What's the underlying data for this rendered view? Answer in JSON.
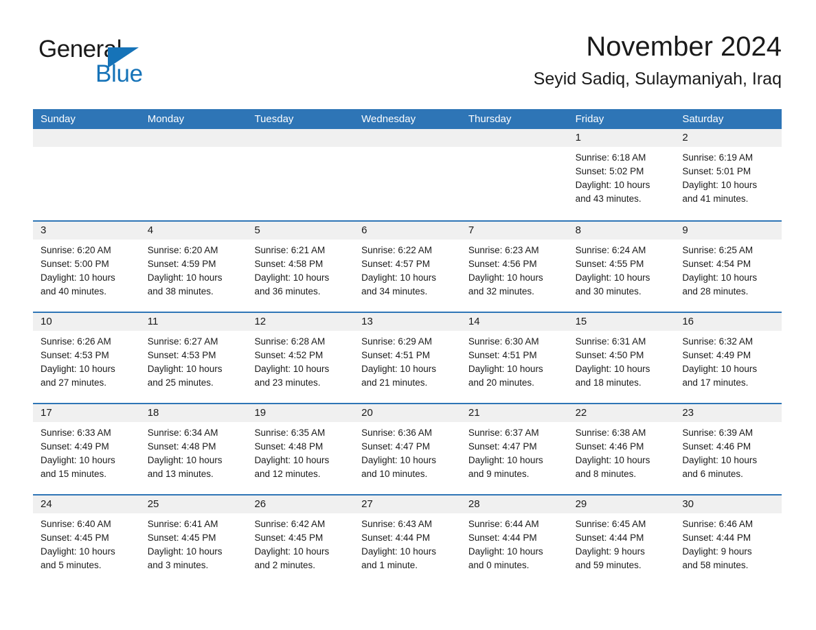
{
  "brand": {
    "name_part1": "General",
    "name_part2": "Blue"
  },
  "header": {
    "title": "November 2024",
    "subtitle": "Seyid Sadiq, Sulaymaniyah, Iraq"
  },
  "colors": {
    "header_blue": "#2e75b6",
    "day_band": "#f0f0f0",
    "logo_blue": "#1673b8",
    "text": "#1a1a1a"
  },
  "weekdays": [
    "Sunday",
    "Monday",
    "Tuesday",
    "Wednesday",
    "Thursday",
    "Friday",
    "Saturday"
  ],
  "weeks": [
    [
      {
        "day": "",
        "empty": true
      },
      {
        "day": "",
        "empty": true
      },
      {
        "day": "",
        "empty": true
      },
      {
        "day": "",
        "empty": true
      },
      {
        "day": "",
        "empty": true
      },
      {
        "day": "1",
        "sunrise": "Sunrise: 6:18 AM",
        "sunset": "Sunset: 5:02 PM",
        "daylight_l1": "Daylight: 10 hours",
        "daylight_l2": "and 43 minutes."
      },
      {
        "day": "2",
        "sunrise": "Sunrise: 6:19 AM",
        "sunset": "Sunset: 5:01 PM",
        "daylight_l1": "Daylight: 10 hours",
        "daylight_l2": "and 41 minutes."
      }
    ],
    [
      {
        "day": "3",
        "sunrise": "Sunrise: 6:20 AM",
        "sunset": "Sunset: 5:00 PM",
        "daylight_l1": "Daylight: 10 hours",
        "daylight_l2": "and 40 minutes."
      },
      {
        "day": "4",
        "sunrise": "Sunrise: 6:20 AM",
        "sunset": "Sunset: 4:59 PM",
        "daylight_l1": "Daylight: 10 hours",
        "daylight_l2": "and 38 minutes."
      },
      {
        "day": "5",
        "sunrise": "Sunrise: 6:21 AM",
        "sunset": "Sunset: 4:58 PM",
        "daylight_l1": "Daylight: 10 hours",
        "daylight_l2": "and 36 minutes."
      },
      {
        "day": "6",
        "sunrise": "Sunrise: 6:22 AM",
        "sunset": "Sunset: 4:57 PM",
        "daylight_l1": "Daylight: 10 hours",
        "daylight_l2": "and 34 minutes."
      },
      {
        "day": "7",
        "sunrise": "Sunrise: 6:23 AM",
        "sunset": "Sunset: 4:56 PM",
        "daylight_l1": "Daylight: 10 hours",
        "daylight_l2": "and 32 minutes."
      },
      {
        "day": "8",
        "sunrise": "Sunrise: 6:24 AM",
        "sunset": "Sunset: 4:55 PM",
        "daylight_l1": "Daylight: 10 hours",
        "daylight_l2": "and 30 minutes."
      },
      {
        "day": "9",
        "sunrise": "Sunrise: 6:25 AM",
        "sunset": "Sunset: 4:54 PM",
        "daylight_l1": "Daylight: 10 hours",
        "daylight_l2": "and 28 minutes."
      }
    ],
    [
      {
        "day": "10",
        "sunrise": "Sunrise: 6:26 AM",
        "sunset": "Sunset: 4:53 PM",
        "daylight_l1": "Daylight: 10 hours",
        "daylight_l2": "and 27 minutes."
      },
      {
        "day": "11",
        "sunrise": "Sunrise: 6:27 AM",
        "sunset": "Sunset: 4:53 PM",
        "daylight_l1": "Daylight: 10 hours",
        "daylight_l2": "and 25 minutes."
      },
      {
        "day": "12",
        "sunrise": "Sunrise: 6:28 AM",
        "sunset": "Sunset: 4:52 PM",
        "daylight_l1": "Daylight: 10 hours",
        "daylight_l2": "and 23 minutes."
      },
      {
        "day": "13",
        "sunrise": "Sunrise: 6:29 AM",
        "sunset": "Sunset: 4:51 PM",
        "daylight_l1": "Daylight: 10 hours",
        "daylight_l2": "and 21 minutes."
      },
      {
        "day": "14",
        "sunrise": "Sunrise: 6:30 AM",
        "sunset": "Sunset: 4:51 PM",
        "daylight_l1": "Daylight: 10 hours",
        "daylight_l2": "and 20 minutes."
      },
      {
        "day": "15",
        "sunrise": "Sunrise: 6:31 AM",
        "sunset": "Sunset: 4:50 PM",
        "daylight_l1": "Daylight: 10 hours",
        "daylight_l2": "and 18 minutes."
      },
      {
        "day": "16",
        "sunrise": "Sunrise: 6:32 AM",
        "sunset": "Sunset: 4:49 PM",
        "daylight_l1": "Daylight: 10 hours",
        "daylight_l2": "and 17 minutes."
      }
    ],
    [
      {
        "day": "17",
        "sunrise": "Sunrise: 6:33 AM",
        "sunset": "Sunset: 4:49 PM",
        "daylight_l1": "Daylight: 10 hours",
        "daylight_l2": "and 15 minutes."
      },
      {
        "day": "18",
        "sunrise": "Sunrise: 6:34 AM",
        "sunset": "Sunset: 4:48 PM",
        "daylight_l1": "Daylight: 10 hours",
        "daylight_l2": "and 13 minutes."
      },
      {
        "day": "19",
        "sunrise": "Sunrise: 6:35 AM",
        "sunset": "Sunset: 4:48 PM",
        "daylight_l1": "Daylight: 10 hours",
        "daylight_l2": "and 12 minutes."
      },
      {
        "day": "20",
        "sunrise": "Sunrise: 6:36 AM",
        "sunset": "Sunset: 4:47 PM",
        "daylight_l1": "Daylight: 10 hours",
        "daylight_l2": "and 10 minutes."
      },
      {
        "day": "21",
        "sunrise": "Sunrise: 6:37 AM",
        "sunset": "Sunset: 4:47 PM",
        "daylight_l1": "Daylight: 10 hours",
        "daylight_l2": "and 9 minutes."
      },
      {
        "day": "22",
        "sunrise": "Sunrise: 6:38 AM",
        "sunset": "Sunset: 4:46 PM",
        "daylight_l1": "Daylight: 10 hours",
        "daylight_l2": "and 8 minutes."
      },
      {
        "day": "23",
        "sunrise": "Sunrise: 6:39 AM",
        "sunset": "Sunset: 4:46 PM",
        "daylight_l1": "Daylight: 10 hours",
        "daylight_l2": "and 6 minutes."
      }
    ],
    [
      {
        "day": "24",
        "sunrise": "Sunrise: 6:40 AM",
        "sunset": "Sunset: 4:45 PM",
        "daylight_l1": "Daylight: 10 hours",
        "daylight_l2": "and 5 minutes."
      },
      {
        "day": "25",
        "sunrise": "Sunrise: 6:41 AM",
        "sunset": "Sunset: 4:45 PM",
        "daylight_l1": "Daylight: 10 hours",
        "daylight_l2": "and 3 minutes."
      },
      {
        "day": "26",
        "sunrise": "Sunrise: 6:42 AM",
        "sunset": "Sunset: 4:45 PM",
        "daylight_l1": "Daylight: 10 hours",
        "daylight_l2": "and 2 minutes."
      },
      {
        "day": "27",
        "sunrise": "Sunrise: 6:43 AM",
        "sunset": "Sunset: 4:44 PM",
        "daylight_l1": "Daylight: 10 hours",
        "daylight_l2": "and 1 minute."
      },
      {
        "day": "28",
        "sunrise": "Sunrise: 6:44 AM",
        "sunset": "Sunset: 4:44 PM",
        "daylight_l1": "Daylight: 10 hours",
        "daylight_l2": "and 0 minutes."
      },
      {
        "day": "29",
        "sunrise": "Sunrise: 6:45 AM",
        "sunset": "Sunset: 4:44 PM",
        "daylight_l1": "Daylight: 9 hours",
        "daylight_l2": "and 59 minutes."
      },
      {
        "day": "30",
        "sunrise": "Sunrise: 6:46 AM",
        "sunset": "Sunset: 4:44 PM",
        "daylight_l1": "Daylight: 9 hours",
        "daylight_l2": "and 58 minutes."
      }
    ]
  ]
}
